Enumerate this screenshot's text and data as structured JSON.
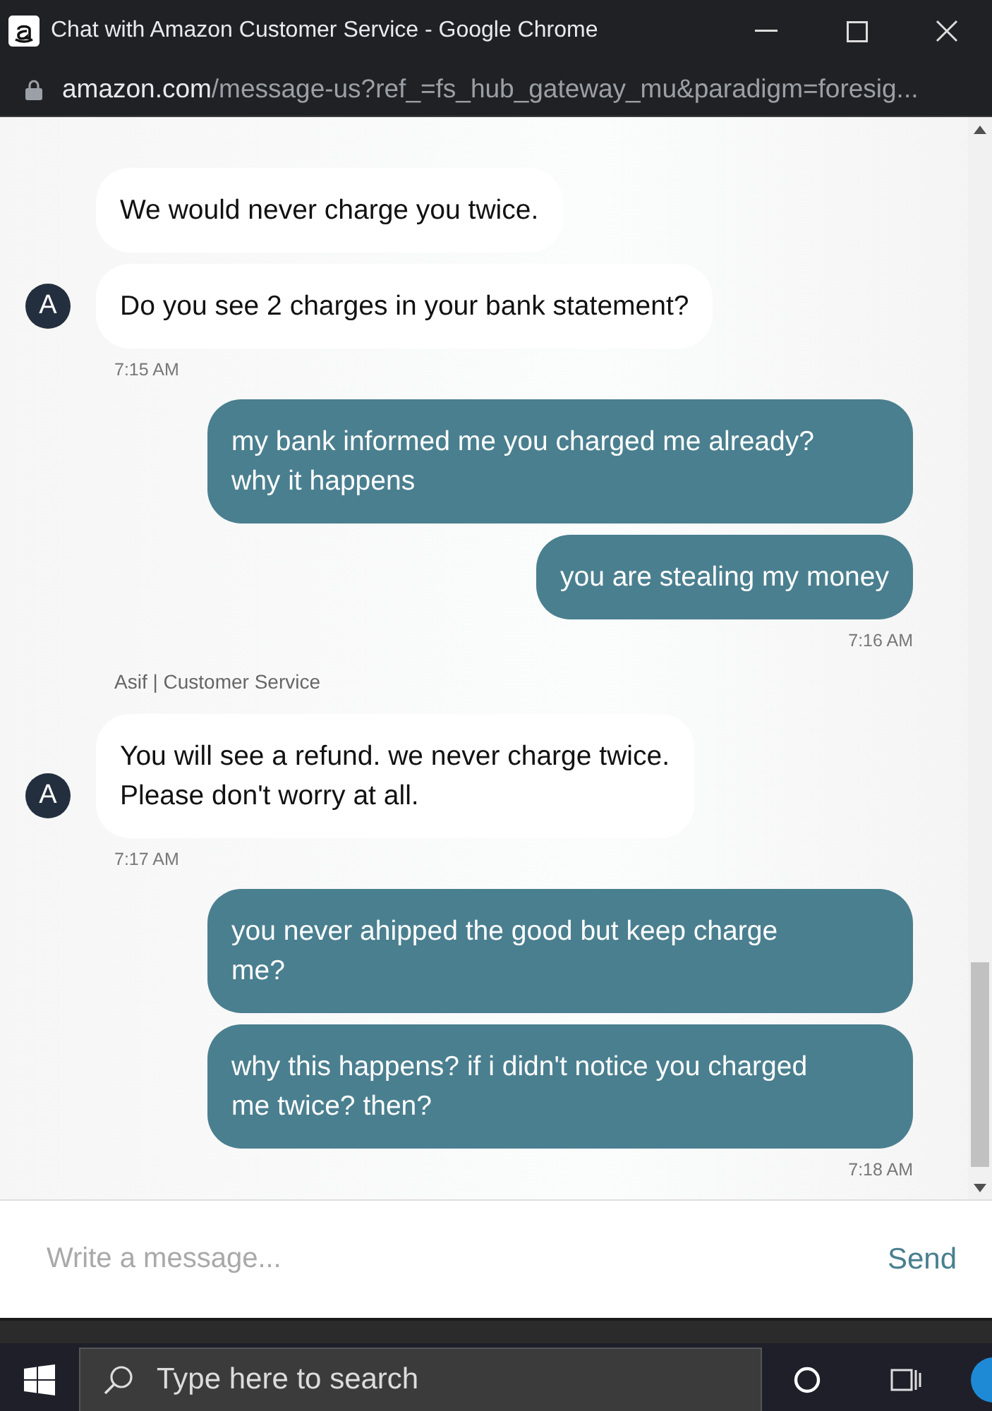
{
  "window": {
    "title": "Chat with Amazon Customer Service - Google Chrome",
    "url_host": "amazon.com",
    "url_path": "/message-us?ref_=fs_hub_gateway_mu&paradigm=foresig..."
  },
  "chat": {
    "groups": [
      {
        "kind": "incoming",
        "avatar": "A",
        "messages": [
          "We would never charge you twice.",
          "Do you see 2 charges in your bank statement?"
        ],
        "time": "7:15 AM"
      },
      {
        "kind": "outgoing",
        "messages": [
          "my bank informed me you charged me already?\nwhy it happens",
          "you are stealing my money"
        ],
        "time": "7:16 AM"
      },
      {
        "kind": "incoming",
        "sender": "Asif | Customer Service",
        "avatar": "A",
        "messages": [
          "You will see a refund. we never charge twice.\nPlease don't worry at all."
        ],
        "time": "7:17 AM"
      },
      {
        "kind": "outgoing",
        "messages": [
          "you never ahipped the good but keep charge\nme?",
          "why this happens? if i didn't notice you charged\nme twice? then?"
        ],
        "time": "7:18 AM"
      }
    ]
  },
  "composer": {
    "placeholder": "Write a message...",
    "send": "Send"
  },
  "taskbar": {
    "search_placeholder": "Type here to search"
  }
}
